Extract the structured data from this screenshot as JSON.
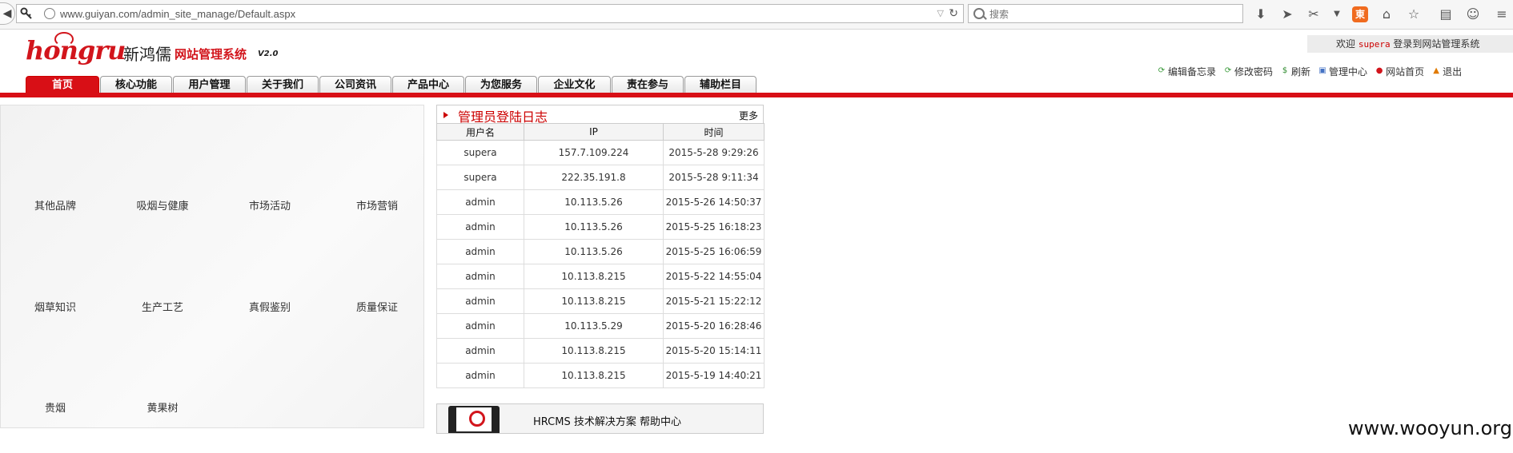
{
  "browser": {
    "url": "www.guiyan.com/admin_site_manage/Default.aspx",
    "search_placeholder": "搜索",
    "icons": [
      "download-icon",
      "send-icon",
      "tools-icon",
      "dropdown-icon",
      "addon-icon",
      "home-icon",
      "bookmark-star-icon",
      "reader-icon",
      "smiley-icon",
      "menu-icon"
    ]
  },
  "header": {
    "logo_text": "hongru",
    "logo_cn": "新鸿儒",
    "system_name": "网站管理系统",
    "version": "V2.0",
    "welcome_prefix": "欢迎",
    "username": "supera",
    "welcome_suffix": "登录到网站管理系统"
  },
  "quick_links": [
    {
      "label": "编辑备忘录",
      "icon": "refresh-icon",
      "color": "#3a9a3a"
    },
    {
      "label": "修改密码",
      "icon": "refresh-icon",
      "color": "#3a9a3a"
    },
    {
      "label": "刷新",
      "icon": "dollar-icon",
      "color": "#2e8b2e"
    },
    {
      "label": "管理中心",
      "icon": "manage-icon",
      "color": "#4472c4"
    },
    {
      "label": "网站首页",
      "icon": "home-icon",
      "color": "#d2151c"
    },
    {
      "label": "退出",
      "icon": "lock-icon",
      "color": "#e07a00"
    }
  ],
  "nav": {
    "tabs": [
      "首页",
      "核心功能",
      "用户管理",
      "关于我们",
      "公司资讯",
      "产品中心",
      "为您服务",
      "企业文化",
      "责在参与",
      "辅助栏目"
    ]
  },
  "categories": [
    "其他品牌",
    "吸烟与健康",
    "市场活动",
    "市场营销",
    "烟草知识",
    "生产工艺",
    "真假鉴别",
    "质量保证",
    "贵烟",
    "黄果树"
  ],
  "login_log": {
    "title": "管理员登陆日志",
    "more": "更多",
    "columns": [
      "用户名",
      "IP",
      "时间"
    ],
    "rows": [
      [
        "supera",
        "157.7.109.224",
        "2015-5-28 9:29:26"
      ],
      [
        "supera",
        "222.35.191.8",
        "2015-5-28 9:11:34"
      ],
      [
        "admin",
        "10.113.5.26",
        "2015-5-26 14:50:37"
      ],
      [
        "admin",
        "10.113.5.26",
        "2015-5-25 16:18:23"
      ],
      [
        "admin",
        "10.113.5.26",
        "2015-5-25 16:06:59"
      ],
      [
        "admin",
        "10.113.8.215",
        "2015-5-22 14:55:04"
      ],
      [
        "admin",
        "10.113.8.215",
        "2015-5-21 15:22:12"
      ],
      [
        "admin",
        "10.113.5.29",
        "2015-5-20 16:28:46"
      ],
      [
        "admin",
        "10.113.8.215",
        "2015-5-20 15:14:11"
      ],
      [
        "admin",
        "10.113.8.215",
        "2015-5-19 14:40:21"
      ]
    ]
  },
  "promo": {
    "text": "HRCMS 技术解决方案  帮助中心"
  },
  "watermark": "www.wooyun.org"
}
